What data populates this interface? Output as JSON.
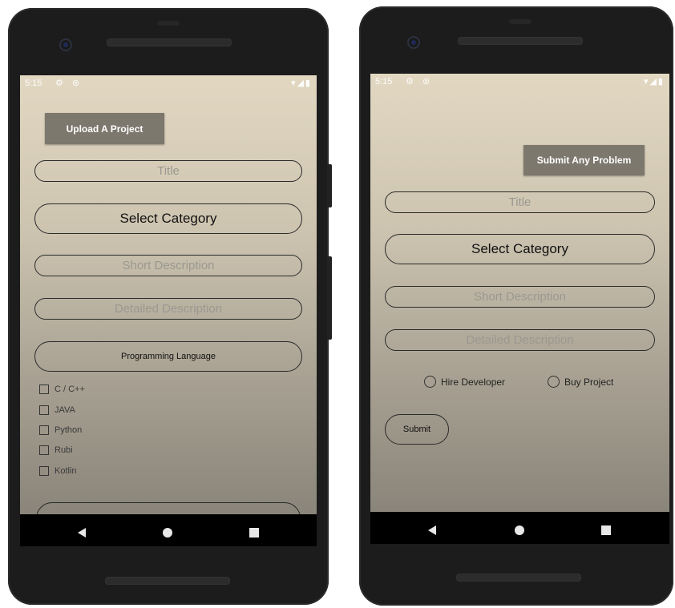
{
  "left_phone": {
    "status": {
      "time": "5:15",
      "icons": "⚙ ⊚",
      "right": "▾◢▮"
    },
    "upload_button": "Upload A Project",
    "fields": {
      "title": "Title",
      "category": "Select Category",
      "short_description": "Short Description",
      "detailed_description": "Detailed Description",
      "programming_language": "Programming Language"
    },
    "languages": [
      "C / C++",
      "JAVA",
      "Python",
      "Rubi",
      "Kotlin"
    ]
  },
  "right_phone": {
    "status": {
      "time": "5:15",
      "icons": "⚙ ⊚",
      "right": "▾◢▮"
    },
    "submit_problem_button": "Submit Any Problem",
    "fields": {
      "title": "Title",
      "category": "Select Category",
      "short_description": "Short Description",
      "detailed_description": "Detailed Description"
    },
    "radios": [
      "Hire Developer",
      "Buy Project"
    ],
    "submit_button": "Submit"
  },
  "colors": {
    "screen_top": "#e2d8c2",
    "screen_bottom": "#8a857a",
    "button_fill": "#7d786e",
    "phone_body": "#1c1c1c"
  },
  "icons": {
    "nav_back": "back-triangle-icon",
    "nav_home": "home-circle-icon",
    "nav_recent": "recents-square-icon"
  }
}
